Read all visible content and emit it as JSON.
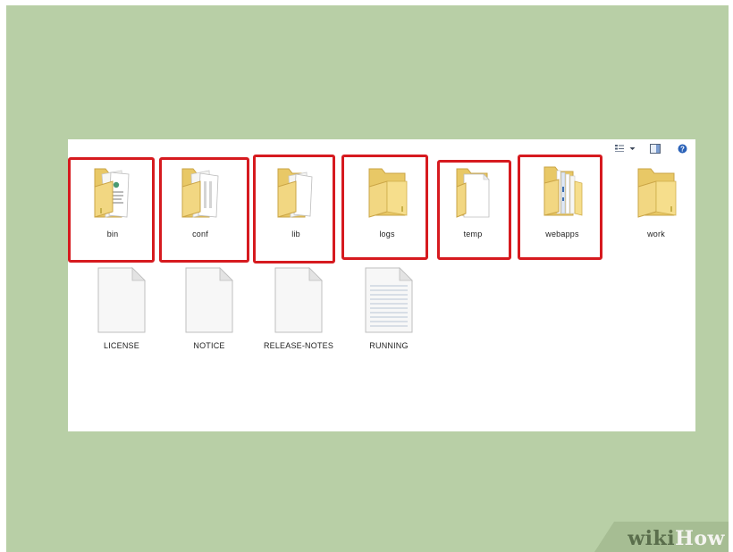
{
  "colors": {
    "background": "#b8cfa6",
    "window": "#ffffff",
    "highlight": "#d61a1f",
    "folder": "#f2d782",
    "help_icon": "#2b62b8"
  },
  "toolbar": {
    "views_icon": "views-icon",
    "dropdown_icon": "chevron-down-icon",
    "preview_pane_icon": "preview-pane-icon",
    "help_icon": "help-icon",
    "help_glyph": "?"
  },
  "folders": [
    {
      "name": "bin",
      "highlighted": true,
      "icon": "folder-with-documents-icon"
    },
    {
      "name": "conf",
      "highlighted": true,
      "icon": "folder-with-documents-icon"
    },
    {
      "name": "lib",
      "highlighted": true,
      "icon": "folder-with-documents-icon"
    },
    {
      "name": "logs",
      "highlighted": true,
      "icon": "empty-folder-icon"
    },
    {
      "name": "temp",
      "highlighted": true,
      "icon": "folder-with-document-icon"
    },
    {
      "name": "webapps",
      "highlighted": true,
      "icon": "folder-with-documents-icon"
    },
    {
      "name": "work",
      "highlighted": false,
      "icon": "empty-folder-icon"
    }
  ],
  "files": [
    {
      "name": "LICENSE",
      "icon": "document-icon"
    },
    {
      "name": "NOTICE",
      "icon": "document-icon"
    },
    {
      "name": "RELEASE-NOTES",
      "icon": "document-icon"
    },
    {
      "name": "RUNNING",
      "icon": "text-document-icon"
    }
  ],
  "watermark": {
    "part1": "wiki",
    "part2": "How"
  }
}
